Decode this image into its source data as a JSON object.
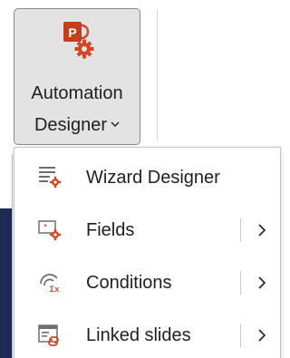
{
  "ribbon": {
    "automation_designer": {
      "label_line1": "Automation",
      "label_line2": "Designer",
      "dropdown_indicator": "ˇ",
      "icon": "powerpoint-gear-icon"
    }
  },
  "menu": {
    "items": [
      {
        "label": "Wizard Designer",
        "icon": "wizard-designer-icon",
        "has_submenu": false
      },
      {
        "label": "Fields",
        "icon": "fields-icon",
        "has_submenu": true
      },
      {
        "label": "Conditions",
        "icon": "conditions-icon",
        "has_submenu": true
      },
      {
        "label": "Linked slides",
        "icon": "linked-slides-icon",
        "has_submenu": true
      }
    ]
  },
  "colors": {
    "brand_red": "#c43e1c",
    "accent_orange": "#d24726",
    "icon_gray": "#6e6e6e",
    "button_bg": "#e3e3e3"
  }
}
